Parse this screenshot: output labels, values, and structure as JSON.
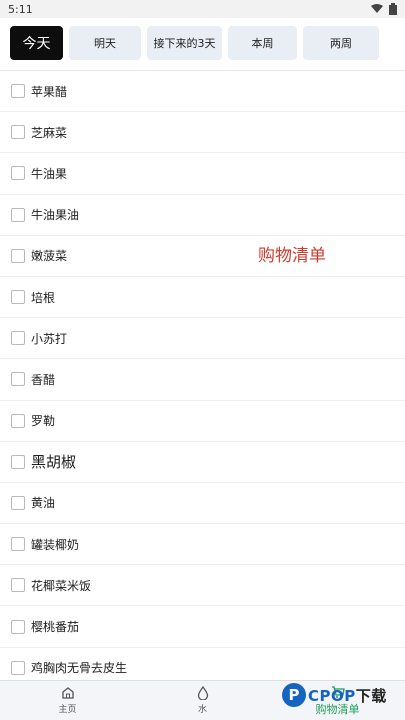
{
  "status_bar": {
    "time": "5:11"
  },
  "tabs": [
    {
      "label": "今天",
      "active": true
    },
    {
      "label": "明天",
      "active": false
    },
    {
      "label": "接下来的3天",
      "active": false
    },
    {
      "label": "本周",
      "active": false
    },
    {
      "label": "两周",
      "active": false
    }
  ],
  "items": [
    {
      "label": "苹果醋"
    },
    {
      "label": "芝麻菜"
    },
    {
      "label": "牛油果"
    },
    {
      "label": "牛油果油"
    },
    {
      "label": "嫩菠菜"
    },
    {
      "label": "培根"
    },
    {
      "label": "小苏打"
    },
    {
      "label": "香醋"
    },
    {
      "label": "罗勒"
    },
    {
      "label": "黑胡椒"
    },
    {
      "label": "黄油"
    },
    {
      "label": "罐装椰奶"
    },
    {
      "label": "花椰菜米饭"
    },
    {
      "label": "樱桃番茄"
    },
    {
      "label": "鸡胸肉无骨去皮生"
    }
  ],
  "overlay_title": "购物清单",
  "bottom_nav": [
    {
      "label": "主页",
      "icon": "home-icon"
    },
    {
      "label": "水",
      "icon": "water-drop-icon"
    },
    {
      "label": "购物清单",
      "icon": "cart-icon",
      "active": true
    }
  ],
  "watermark": {
    "logo_letter": "P",
    "text_en": "CPOP",
    "text_cn": "下载"
  },
  "colors": {
    "active_tab": "#0d0d0d",
    "tab_bg": "#e9eef5",
    "accent_red": "#d23b30",
    "nav_active": "#1f9e5b",
    "brand_blue": "#1565c0"
  }
}
